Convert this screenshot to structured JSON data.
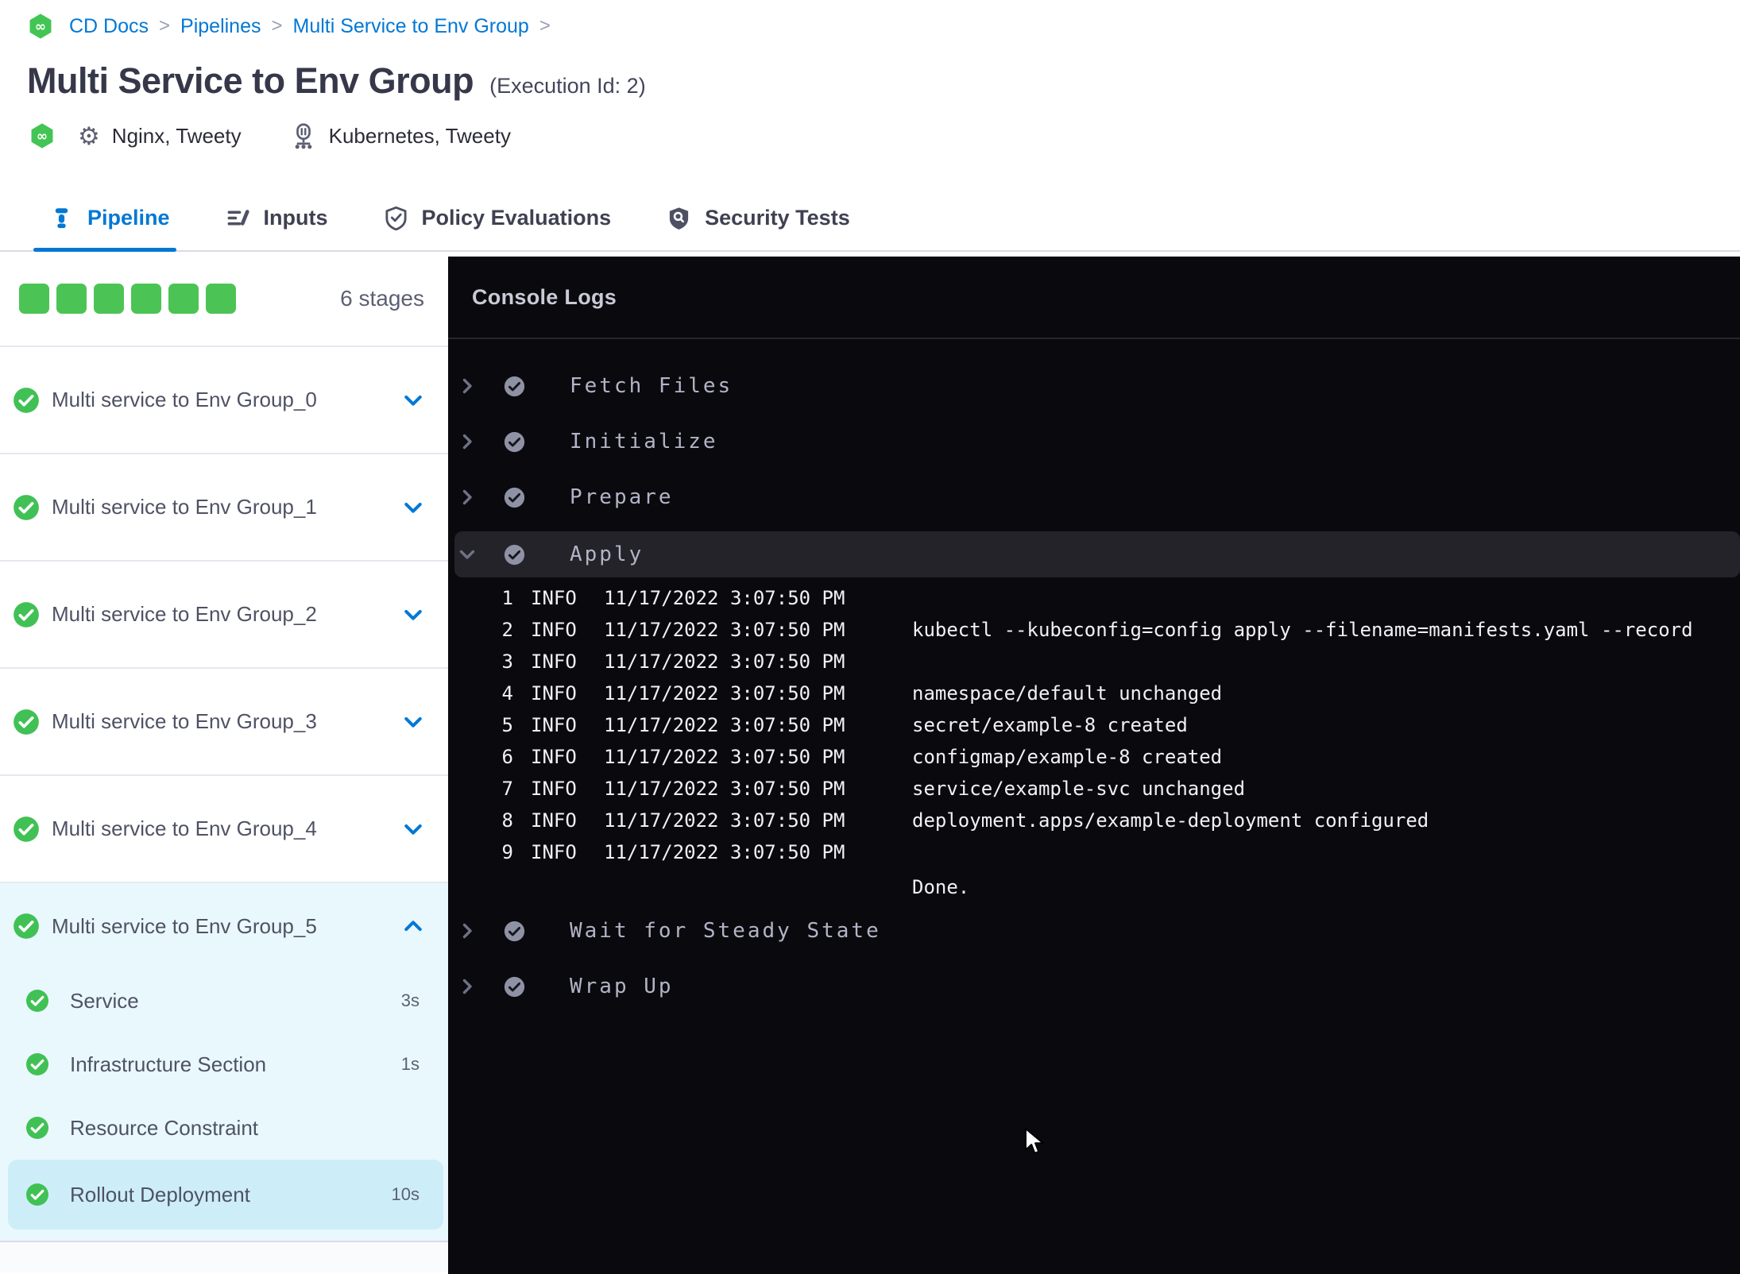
{
  "colors": {
    "accent_blue": "#0278d5",
    "success_green": "#4cc455",
    "console_bg": "#0a0a0e",
    "expanded_stage_bg": "#e9f8fd",
    "selected_step_bg": "#cdeef9"
  },
  "breadcrumb": {
    "separator": ">",
    "items": [
      "CD Docs",
      "Pipelines",
      "Multi Service to Env Group"
    ]
  },
  "header": {
    "title": "Multi Service to Env Group",
    "execution_id": "(Execution Id: 2)",
    "services": [
      {
        "icon": "gear-icon",
        "label": "Nginx, Tweety"
      },
      {
        "icon": "kubernetes-icon",
        "label": "Kubernetes, Tweety"
      }
    ]
  },
  "tabs": [
    {
      "label": "Pipeline",
      "active": true
    },
    {
      "label": "Inputs",
      "active": false
    },
    {
      "label": "Policy Evaluations",
      "active": false
    },
    {
      "label": "Security Tests",
      "active": false
    }
  ],
  "sidebar": {
    "stage_count": 6,
    "stage_count_label": "6 stages",
    "stages": [
      {
        "label": "Multi service to Env Group_0",
        "status": "success",
        "expanded": false
      },
      {
        "label": "Multi service to Env Group_1",
        "status": "success",
        "expanded": false
      },
      {
        "label": "Multi service to Env Group_2",
        "status": "success",
        "expanded": false
      },
      {
        "label": "Multi service to Env Group_3",
        "status": "success",
        "expanded": false
      },
      {
        "label": "Multi service to Env Group_4",
        "status": "success",
        "expanded": false
      },
      {
        "label": "Multi service to Env Group_5",
        "status": "success",
        "expanded": true,
        "steps": [
          {
            "label": "Service",
            "duration": "3s",
            "selected": false
          },
          {
            "label": "Infrastructure Section",
            "duration": "1s",
            "selected": false
          },
          {
            "label": "Resource Constraint",
            "duration": "",
            "selected": false
          },
          {
            "label": "Rollout Deployment",
            "duration": "10s",
            "selected": true
          }
        ]
      }
    ]
  },
  "console": {
    "title": "Console Logs",
    "sections": [
      {
        "label": "Fetch Files",
        "expanded": false
      },
      {
        "label": "Initialize",
        "expanded": false
      },
      {
        "label": "Prepare",
        "expanded": false
      },
      {
        "label": "Apply",
        "expanded": true,
        "logs": [
          {
            "num": "1",
            "level": "INFO",
            "time": "11/17/2022 3:07:50 PM",
            "message": ""
          },
          {
            "num": "2",
            "level": "INFO",
            "time": "11/17/2022 3:07:50 PM",
            "message": "kubectl --kubeconfig=config apply --filename=manifests.yaml --record"
          },
          {
            "num": "3",
            "level": "INFO",
            "time": "11/17/2022 3:07:50 PM",
            "message": ""
          },
          {
            "num": "4",
            "level": "INFO",
            "time": "11/17/2022 3:07:50 PM",
            "message": "namespace/default unchanged"
          },
          {
            "num": "5",
            "level": "INFO",
            "time": "11/17/2022 3:07:50 PM",
            "message": "secret/example-8 created"
          },
          {
            "num": "6",
            "level": "INFO",
            "time": "11/17/2022 3:07:50 PM",
            "message": "configmap/example-8 created"
          },
          {
            "num": "7",
            "level": "INFO",
            "time": "11/17/2022 3:07:50 PM",
            "message": "service/example-svc unchanged"
          },
          {
            "num": "8",
            "level": "INFO",
            "time": "11/17/2022 3:07:50 PM",
            "message": "deployment.apps/example-deployment configured"
          },
          {
            "num": "9",
            "level": "INFO",
            "time": "11/17/2022 3:07:50 PM",
            "message": ""
          }
        ],
        "tail_message": "Done."
      },
      {
        "label": "Wait for Steady State",
        "expanded": false
      },
      {
        "label": "Wrap Up",
        "expanded": false
      }
    ]
  }
}
